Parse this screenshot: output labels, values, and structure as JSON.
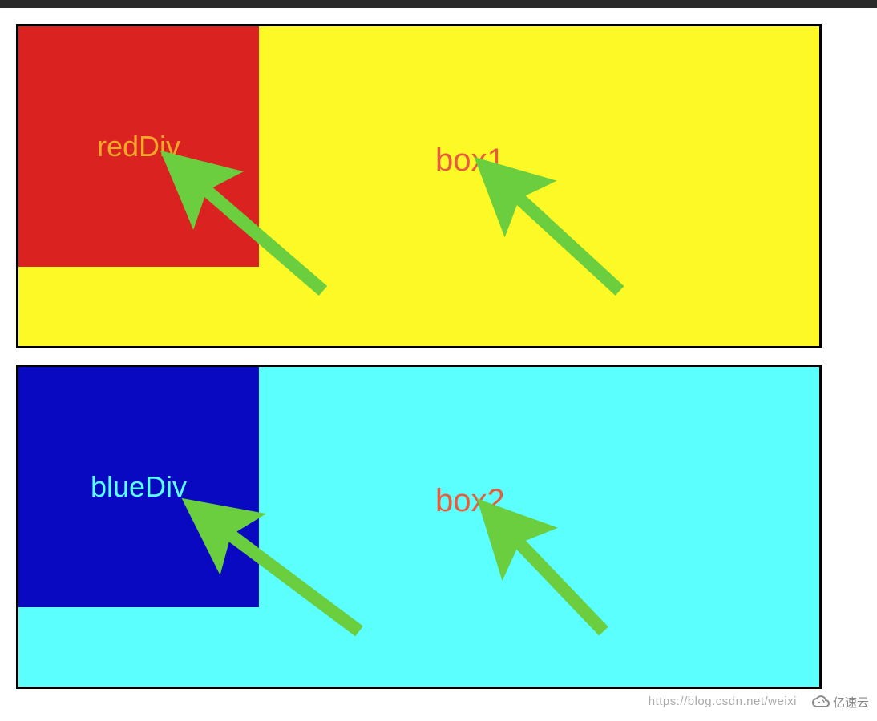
{
  "box1": {
    "inner_label": "redDiv",
    "outer_label": "box1",
    "inner_bg": "#da2221",
    "outer_bg": "#fcf927"
  },
  "box2": {
    "inner_label": "blueDiv",
    "outer_label": "box2",
    "inner_bg": "#0909c2",
    "outer_bg": "#5bfffe"
  },
  "watermark": {
    "text": "https://blog.csdn.net/weixi",
    "logo_text": "亿速云"
  },
  "colors": {
    "arrow": "#6ace3e",
    "label_orange": "#e85c3e"
  }
}
